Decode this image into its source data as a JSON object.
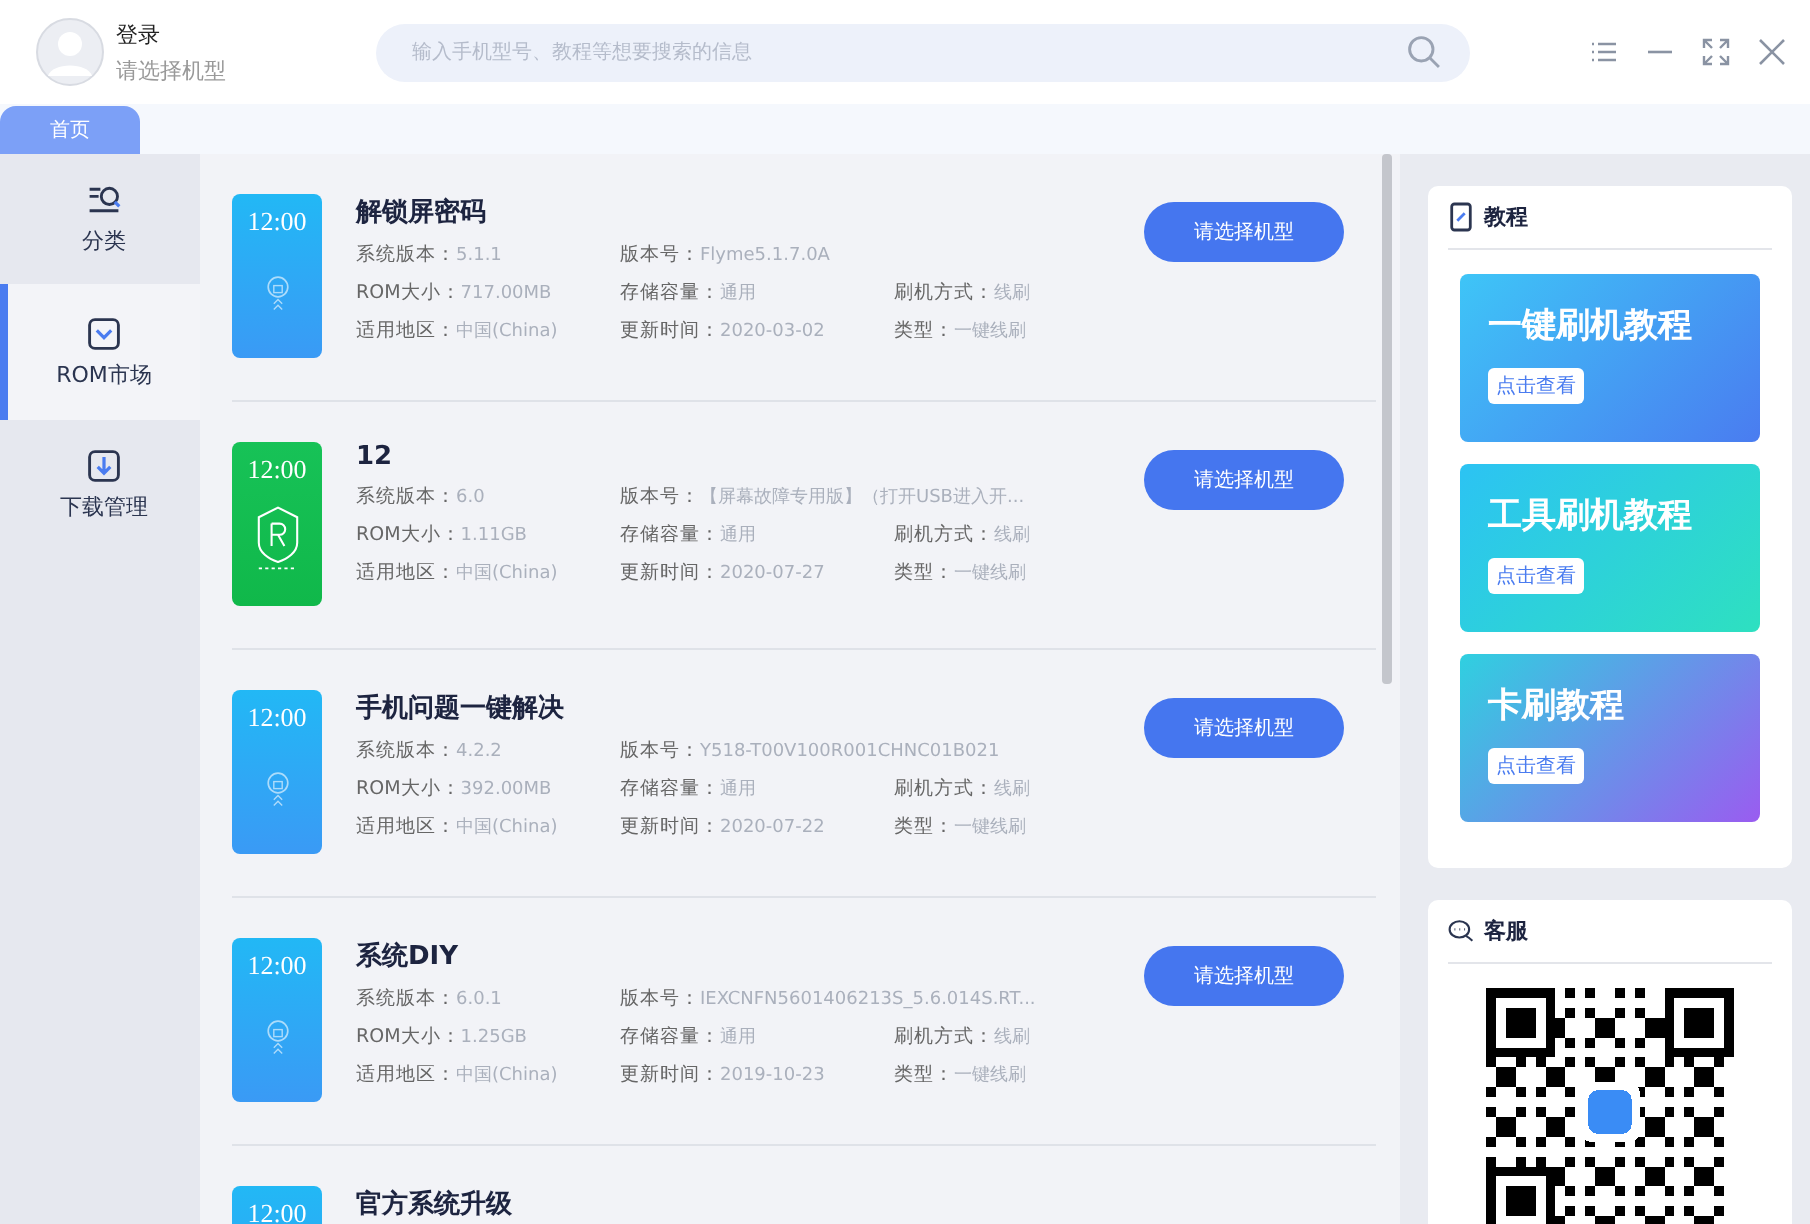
{
  "header": {
    "user_name": "登录",
    "user_hint": "请选择机型",
    "search": {
      "placeholder": "输入手机型号、教程等想要搜索的信息"
    }
  },
  "tabs": [
    {
      "label": "首页",
      "selected": true
    }
  ],
  "sidebar": {
    "items": [
      {
        "label": "分类",
        "kind": "category",
        "selected": false
      },
      {
        "label": "ROM市场",
        "kind": "market",
        "selected": true
      },
      {
        "label": "下载管理",
        "kind": "download",
        "selected": false
      }
    ]
  },
  "roms": [
    {
      "title": "解锁屏密码",
      "thumb": {
        "kind": "lock",
        "time": "12:00"
      },
      "fields": [
        {
          "label": "系统版本：",
          "value": "5.1.1"
        },
        {
          "label": "版本号：",
          "value": "Flyme5.1.7.0A"
        },
        {
          "label": "ROM大小：",
          "value": "717.00MB"
        },
        {
          "label": "存储容量：",
          "value": "通用"
        },
        {
          "label": "刷机方式：",
          "value": "线刷"
        },
        {
          "label": "适用地区：",
          "value": "中国(China)"
        },
        {
          "label": "更新时间：",
          "value": "2020-03-02"
        },
        {
          "label": "类型：",
          "value": "一键线刷"
        }
      ],
      "button": "请选择机型"
    },
    {
      "title": "12",
      "thumb": {
        "kind": "shield",
        "time": "12:00"
      },
      "fields": [
        {
          "label": "系统版本：",
          "value": "6.0"
        },
        {
          "label": "版本号：",
          "value": "【屏幕故障专用版】（打开USB进入开..."
        },
        {
          "label": "ROM大小：",
          "value": "1.11GB"
        },
        {
          "label": "存储容量：",
          "value": "通用"
        },
        {
          "label": "刷机方式：",
          "value": "线刷"
        },
        {
          "label": "适用地区：",
          "value": "中国(China)"
        },
        {
          "label": "更新时间：",
          "value": "2020-07-27"
        },
        {
          "label": "类型：",
          "value": "一键线刷"
        }
      ],
      "button": "请选择机型"
    },
    {
      "title": "手机问题一键解决",
      "thumb": {
        "kind": "lock",
        "time": "12:00"
      },
      "fields": [
        {
          "label": "系统版本：",
          "value": "4.2.2"
        },
        {
          "label": "版本号：",
          "value": "Y518-T00V100R001CHNC01B021"
        },
        {
          "label": "ROM大小：",
          "value": "392.00MB"
        },
        {
          "label": "存储容量：",
          "value": "通用"
        },
        {
          "label": "刷机方式：",
          "value": "线刷"
        },
        {
          "label": "适用地区：",
          "value": "中国(China)"
        },
        {
          "label": "更新时间：",
          "value": "2020-07-22"
        },
        {
          "label": "类型：",
          "value": "一键线刷"
        }
      ],
      "button": "请选择机型"
    },
    {
      "title": "系统DIY",
      "thumb": {
        "kind": "lock",
        "time": "12:00"
      },
      "fields": [
        {
          "label": "系统版本：",
          "value": "6.0.1"
        },
        {
          "label": "版本号：",
          "value": "IEXCNFN5601406213S_5.6.014S.RT..."
        },
        {
          "label": "ROM大小：",
          "value": "1.25GB"
        },
        {
          "label": "存储容量：",
          "value": "通用"
        },
        {
          "label": "刷机方式：",
          "value": "线刷"
        },
        {
          "label": "适用地区：",
          "value": "中国(China)"
        },
        {
          "label": "更新时间：",
          "value": "2019-10-23"
        },
        {
          "label": "类型：",
          "value": "一键线刷"
        }
      ],
      "button": "请选择机型"
    },
    {
      "title": "官方系统升级",
      "thumb": {
        "kind": "lock",
        "time": "12:00"
      }
    }
  ],
  "tutorials": {
    "title": "教程",
    "banners": [
      {
        "title": "一键刷机教程",
        "action": "点击查看",
        "kind": "blue"
      },
      {
        "title": "工具刷机教程",
        "action": "点击查看",
        "kind": "teal"
      },
      {
        "title": "卡刷教程",
        "action": "点击查看",
        "kind": "purple"
      }
    ]
  },
  "service": {
    "title": "客服"
  }
}
